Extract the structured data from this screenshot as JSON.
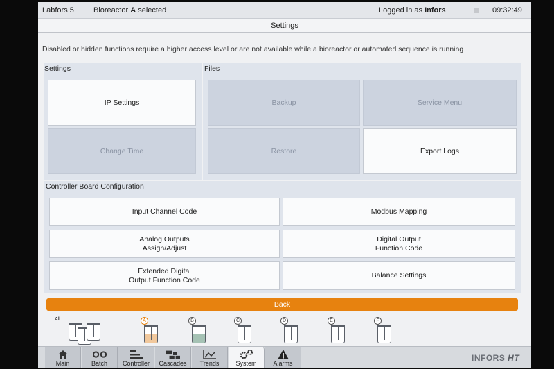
{
  "status": {
    "device": "Labfors 5",
    "bioreactor_prefix": "Bioreactor ",
    "bioreactor_letter": "A",
    "bioreactor_suffix": " selected",
    "user_prefix": "Logged in as ",
    "user_name": "Infors",
    "time": "09:32:49"
  },
  "title": "Settings",
  "notice": "Disabled or hidden functions require a higher access level or are not available while a bioreactor or automated sequence is running",
  "settings_panel": {
    "title": "Settings",
    "ip_settings": "IP Settings",
    "change_time": "Change Time"
  },
  "files_panel": {
    "title": "Files",
    "backup": "Backup",
    "service_menu": "Service Menu",
    "restore": "Restore",
    "export_logs": "Export Logs"
  },
  "controller_panel": {
    "title": "Controller Board Configuration",
    "input_channel_code": "Input Channel Code",
    "modbus_mapping": "Modbus Mapping",
    "analog_outputs_1": "Analog Outputs",
    "analog_outputs_2": "Assign/Adjust",
    "digital_output_1": "Digital Output",
    "digital_output_2": "Function Code",
    "extended_digital_1": "Extended Digital",
    "extended_digital_2": "Output Function Code",
    "balance_settings": "Balance Settings"
  },
  "back_label": "Back",
  "vessels": {
    "all_label": "All",
    "letters": [
      "A",
      "B",
      "C",
      "D",
      "E",
      "F"
    ],
    "colors": {
      "A": "#e8a45a",
      "B": "#7fa894"
    }
  },
  "nav": [
    {
      "label": "Main",
      "icon": "home-icon"
    },
    {
      "label": "Batch",
      "icon": "batch-icon"
    },
    {
      "label": "Controller",
      "icon": "controller-icon"
    },
    {
      "label": "Cascades",
      "icon": "cascades-icon"
    },
    {
      "label": "Trends",
      "icon": "trends-icon"
    },
    {
      "label": "System",
      "icon": "gear-icon"
    },
    {
      "label": "Alarms",
      "icon": "warning-icon"
    }
  ],
  "brand": {
    "text": "INFORS ",
    "suffix": "HT"
  },
  "colors": {
    "accent": "#e7820f",
    "disabled": "#ccd3df"
  }
}
